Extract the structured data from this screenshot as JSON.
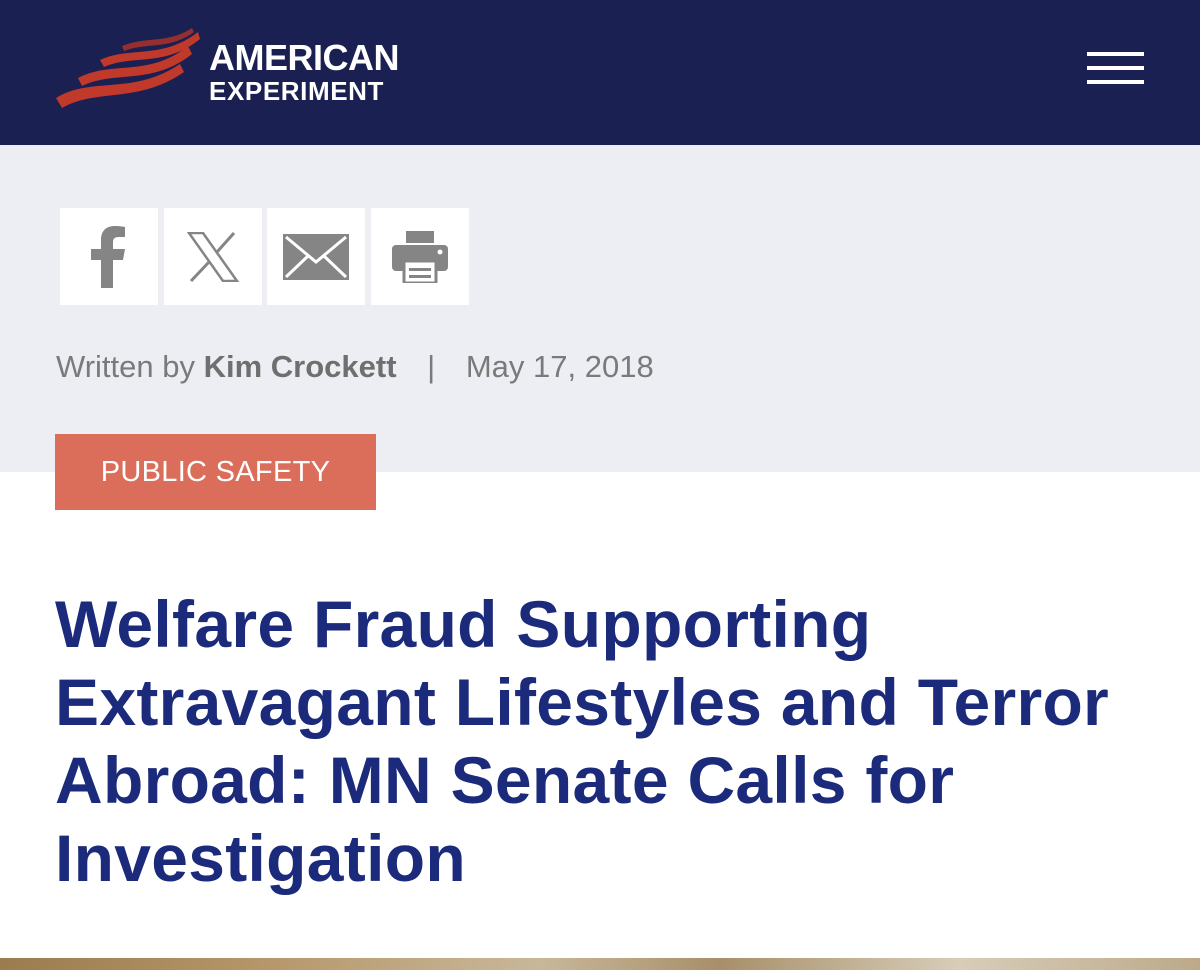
{
  "header": {
    "logo": {
      "line1": "AMERICAN",
      "line2": "EXPERIMENT",
      "flag_colors": [
        "#c0392b",
        "#ffffff"
      ]
    },
    "menu_icon": "hamburger-icon",
    "background": "#1a2051"
  },
  "share": {
    "items": [
      {
        "icon": "facebook-icon"
      },
      {
        "icon": "x-icon"
      },
      {
        "icon": "email-icon"
      },
      {
        "icon": "print-icon"
      }
    ]
  },
  "byline": {
    "prefix": "Written by",
    "author": "Kim Crockett",
    "separator": "|",
    "date": "May 17, 2018",
    "date_highlight_color": "#f2f239"
  },
  "article": {
    "category": "PUBLIC SAFETY",
    "category_color": "#db6e5a",
    "title": "Welfare Fraud Supporting Extravagant Lifestyles and Terror Abroad: MN Senate Calls for Investigation",
    "title_color": "#1b2a7a"
  }
}
